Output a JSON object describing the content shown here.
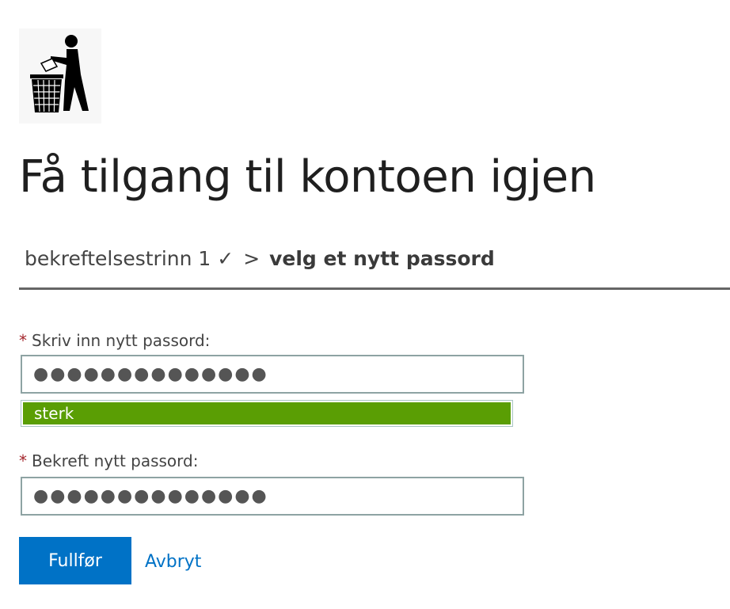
{
  "logo": {
    "icon": "tidy-man-trash-icon"
  },
  "title": "Få tilgang til kontoen igjen",
  "breadcrumb": {
    "step1": "bekreftelsestrinn 1 ✓",
    "separator": ">",
    "current": "velg et nytt passord"
  },
  "form": {
    "new_password": {
      "required_marker": "*",
      "label": "Skriv inn nytt passord:",
      "value": "●●●●●●●●●●●●●●"
    },
    "strength": {
      "label": "sterk",
      "color": "#5a9e04"
    },
    "confirm_password": {
      "required_marker": "*",
      "label": "Bekreft nytt passord:",
      "value": "●●●●●●●●●●●●●●"
    }
  },
  "actions": {
    "finish_label": "Fullfør",
    "cancel_label": "Avbryt"
  },
  "colors": {
    "accent": "#0072c6",
    "required": "#a4262c",
    "strength_strong": "#5a9e04"
  }
}
